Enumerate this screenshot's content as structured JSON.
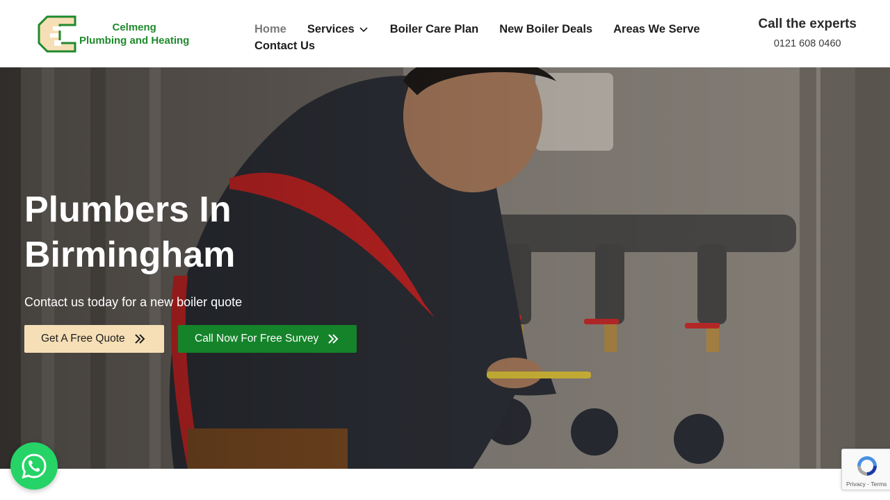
{
  "brand": {
    "name_line1": "Celmeng",
    "name_line2": "Plumbing and Heating",
    "primary_green": "#1f8a2c"
  },
  "nav": {
    "items": [
      {
        "label": "Home",
        "active": true
      },
      {
        "label": "Services",
        "has_dropdown": true
      },
      {
        "label": "Boiler Care Plan"
      },
      {
        "label": "New Boiler Deals"
      },
      {
        "label": "Areas We Serve"
      },
      {
        "label": "Contact Us"
      }
    ]
  },
  "header_cta": {
    "title": "Call the experts",
    "phone": "0121 608 0460"
  },
  "hero": {
    "title_line1": "Plumbers In",
    "title_line2": "Birmingham",
    "subtitle": "Contact us today for a new boiler quote",
    "buttons": {
      "quote_label": "Get A Free Quote",
      "call_label": "Call Now For Free Survey"
    },
    "button_colors": {
      "quote_bg": "#f6dfb6",
      "call_bg": "#14832a"
    }
  },
  "recaptcha": {
    "links": "Privacy - Terms"
  },
  "icons": {
    "dropdown": "chevron-down-icon",
    "button_arrow": "double-chevron-right-icon",
    "floating": "whatsapp-icon"
  }
}
